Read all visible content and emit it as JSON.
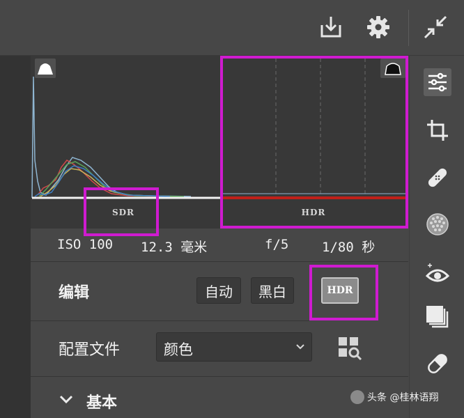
{
  "histogram": {
    "sdr_label": "SDR",
    "hdr_label": "HDR"
  },
  "exif": {
    "iso": "ISO 100",
    "focal": "12.3 毫米",
    "aperture": "f/5",
    "shutter": "1/80 秒"
  },
  "edit": {
    "label": "编辑",
    "auto_label": "自动",
    "bw_label": "黑白",
    "hdr_label": "HDR"
  },
  "profile": {
    "label": "配置文件",
    "selected": "颜色"
  },
  "basic": {
    "label": "基本"
  },
  "watermark": {
    "text": "头条 @桂林语翔"
  },
  "colors": {
    "highlight": "#cf1bd0",
    "panel_bg": "#474747",
    "histogram_bg": "#383838",
    "hdr_line": "#c0201a"
  },
  "icons": {
    "top": [
      "export-icon",
      "settings-gear-icon",
      "collapse-icon"
    ],
    "sidebar": [
      "edit-sliders-icon",
      "crop-icon",
      "healing-bandage-icon",
      "mask-icon",
      "red-eye-icon",
      "presets-icon",
      "eraser-icon"
    ]
  }
}
